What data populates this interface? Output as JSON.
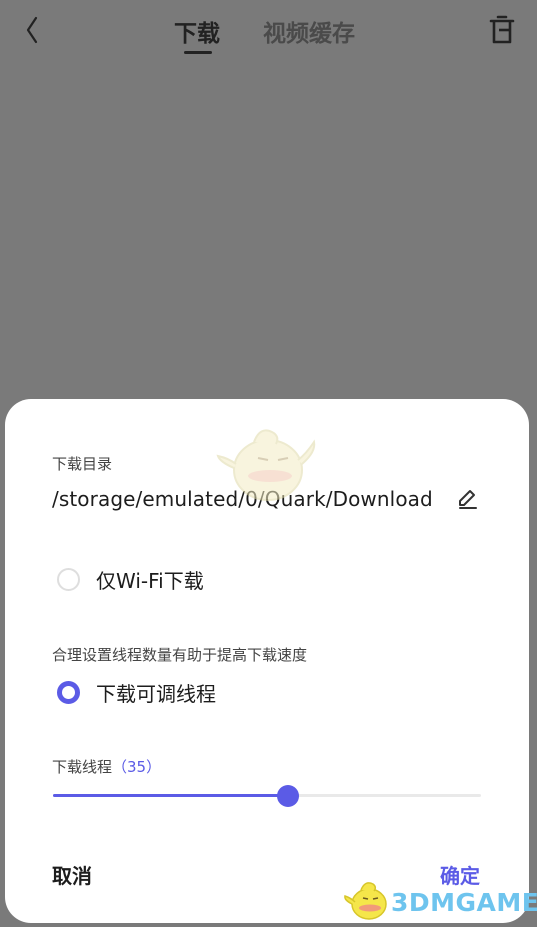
{
  "header": {
    "tabs": [
      {
        "label": "下载",
        "active": true
      },
      {
        "label": "视频缓存",
        "active": false
      }
    ],
    "icons": {
      "back": "chevron-left-icon",
      "delete": "trash-icon"
    }
  },
  "sheet": {
    "directory_label": "下载目录",
    "directory_path": "/storage/emulated/0/Quark/Download",
    "wifi_only_label": "仅Wi-Fi下载",
    "wifi_only_checked": false,
    "thread_hint": "合理设置线程数量有助于提高下载速度",
    "adjustable_threads_label": "下载可调线程",
    "adjustable_threads_checked": true,
    "threads_label": "下载线程",
    "threads_value_text": "（35）",
    "threads_slider_fraction": 0.55,
    "cancel_label": "取消",
    "confirm_label": "确定"
  },
  "colors": {
    "accent": "#5b5be6",
    "overlay": "#7a7a7a"
  },
  "watermark": {
    "text": "3DMGAME"
  }
}
